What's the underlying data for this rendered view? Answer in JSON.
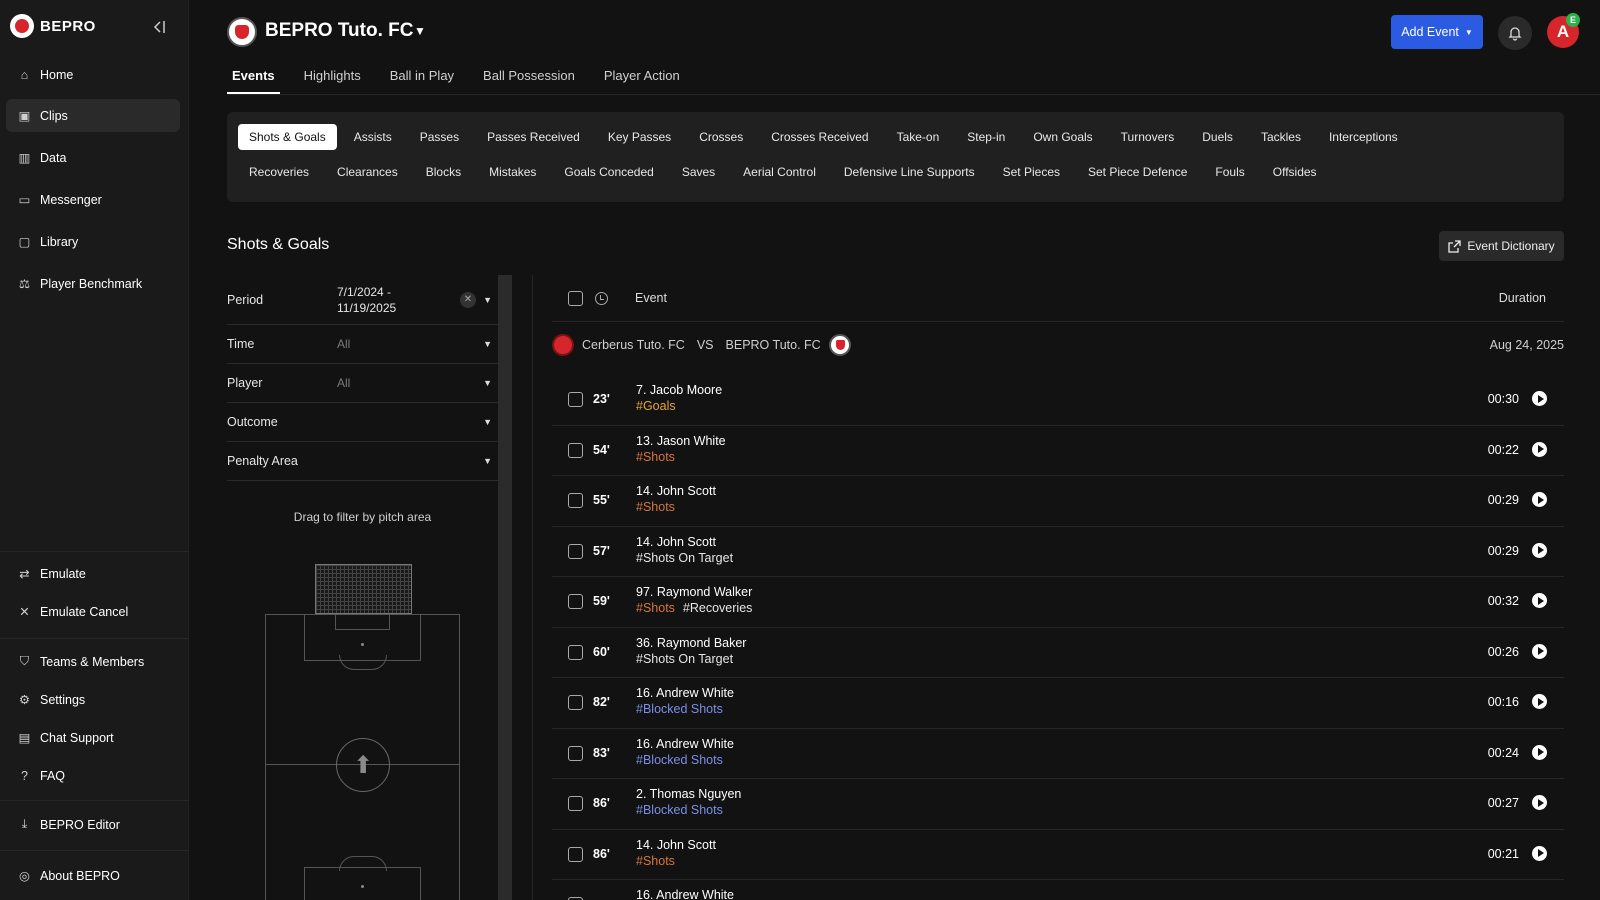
{
  "brand": {
    "name": "BEPRO",
    "accent": "#2b5be3",
    "brand_red": "#d7262b"
  },
  "sidebar": {
    "items": [
      {
        "label": "Home",
        "icon": "home-icon"
      },
      {
        "label": "Clips",
        "icon": "clip-icon",
        "active": true
      },
      {
        "label": "Data",
        "icon": "chart-icon"
      },
      {
        "label": "Messenger",
        "icon": "chat-icon"
      },
      {
        "label": "Library",
        "icon": "folder-icon"
      },
      {
        "label": "Player Benchmark",
        "icon": "scale-icon"
      }
    ],
    "mid_items": [
      {
        "label": "Emulate",
        "icon": "swap-icon"
      },
      {
        "label": "Emulate Cancel",
        "icon": "close-icon"
      }
    ],
    "bottom_items": [
      {
        "label": "Teams & Members",
        "icon": "shield-icon"
      },
      {
        "label": "Settings",
        "icon": "gear-icon"
      },
      {
        "label": "Chat Support",
        "icon": "support-icon"
      },
      {
        "label": "FAQ",
        "icon": "help-icon"
      }
    ],
    "editor_item": {
      "label": "BEPRO Editor",
      "icon": "download-icon"
    },
    "about_item": {
      "label": "About BEPRO",
      "icon": "info-icon"
    }
  },
  "header": {
    "team": "BEPRO Tuto. FC",
    "add_event": "Add Event",
    "avatar_letter": "A",
    "avatar_badge": "E"
  },
  "tabs": [
    "Events",
    "Highlights",
    "Ball in Play",
    "Ball Possession",
    "Player Action"
  ],
  "categories": {
    "row1": [
      "Shots & Goals",
      "Assists",
      "Passes",
      "Passes Received",
      "Key Passes",
      "Crosses",
      "Crosses Received",
      "Take-on",
      "Step-in",
      "Own Goals",
      "Turnovers",
      "Duels",
      "Tackles",
      "Interceptions"
    ],
    "row2": [
      "Recoveries",
      "Clearances",
      "Blocks",
      "Mistakes",
      "Goals Conceded",
      "Saves",
      "Aerial Control",
      "Defensive Line Supports",
      "Set Pieces",
      "Set Piece Defence",
      "Fouls",
      "Offsides"
    ]
  },
  "section": {
    "title": "Shots & Goals",
    "dictionary": "Event Dictionary"
  },
  "filters": {
    "period": {
      "label": "Period",
      "value_line1": "7/1/2024 -",
      "value_line2": "11/19/2025"
    },
    "time": {
      "label": "Time",
      "value": "All"
    },
    "player": {
      "label": "Player",
      "value": "All"
    },
    "outcome": {
      "label": "Outcome"
    },
    "penalty": {
      "label": "Penalty Area"
    },
    "drag_hint": "Drag to filter by pitch area"
  },
  "list": {
    "col_event": "Event",
    "col_duration": "Duration",
    "match": {
      "home": "Cerberus Tuto. FC",
      "vs": "VS",
      "away": "BEPRO Tuto. FC",
      "date": "Aug 24, 2025"
    },
    "rows": [
      {
        "minute": "23'",
        "player": "7. Jacob Moore",
        "tags": [
          {
            "text": "#Goals",
            "tone": "gold"
          }
        ],
        "duration": "00:30"
      },
      {
        "minute": "54'",
        "player": "13. Jason White",
        "tags": [
          {
            "text": "#Shots",
            "tone": "orange"
          }
        ],
        "duration": "00:22"
      },
      {
        "minute": "55'",
        "player": "14. John Scott",
        "tags": [
          {
            "text": "#Shots",
            "tone": "orange"
          }
        ],
        "duration": "00:29"
      },
      {
        "minute": "57'",
        "player": "14. John Scott",
        "tags": [
          {
            "text": "#Shots On Target",
            "tone": "white"
          }
        ],
        "duration": "00:29"
      },
      {
        "minute": "59'",
        "player": "97. Raymond Walker",
        "tags": [
          {
            "text": "#Shots",
            "tone": "orange"
          },
          {
            "text": "#Recoveries",
            "tone": "white"
          }
        ],
        "duration": "00:32"
      },
      {
        "minute": "60'",
        "player": "36. Raymond Baker",
        "tags": [
          {
            "text": "#Shots On Target",
            "tone": "white"
          }
        ],
        "duration": "00:26"
      },
      {
        "minute": "82'",
        "player": "16. Andrew White",
        "tags": [
          {
            "text": "#Blocked Shots",
            "tone": "blue"
          }
        ],
        "duration": "00:16"
      },
      {
        "minute": "83'",
        "player": "16. Andrew White",
        "tags": [
          {
            "text": "#Blocked Shots",
            "tone": "blue"
          }
        ],
        "duration": "00:24"
      },
      {
        "minute": "86'",
        "player": "2. Thomas Nguyen",
        "tags": [
          {
            "text": "#Blocked Shots",
            "tone": "blue"
          }
        ],
        "duration": "00:27"
      },
      {
        "minute": "86'",
        "player": "14. John Scott",
        "tags": [
          {
            "text": "#Shots",
            "tone": "orange"
          }
        ],
        "duration": "00:21"
      },
      {
        "minute": "",
        "player": "16. Andrew White",
        "tags": [],
        "duration": ""
      }
    ]
  }
}
